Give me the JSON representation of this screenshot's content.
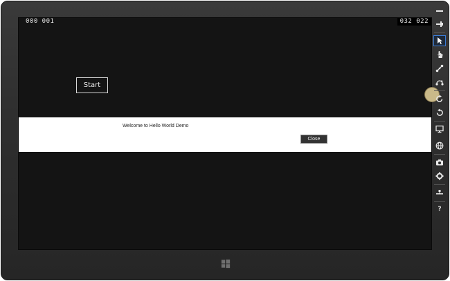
{
  "screen": {
    "counter_left": "000  001",
    "counter_right": "032  022"
  },
  "app": {
    "start_label": "Start"
  },
  "dialog": {
    "message": "Welcome to Hello World Demo",
    "close_label": "Close"
  },
  "toolbar": {
    "tools": [
      {
        "icon": "minimize-icon"
      },
      {
        "icon": "pin-icon"
      },
      {
        "icon": "mouse-pointer-icon",
        "selected": true
      },
      {
        "icon": "touch-hand-icon"
      },
      {
        "icon": "pinch-zoom-icon"
      },
      {
        "icon": "rotate-gesture-icon"
      },
      {
        "icon": "rotate-clockwise-icon"
      },
      {
        "icon": "rotate-counterclockwise-icon"
      },
      {
        "icon": "change-resolution-icon"
      },
      {
        "icon": "set-location-icon"
      },
      {
        "icon": "screenshot-camera-icon"
      },
      {
        "icon": "settings-gear-icon"
      },
      {
        "icon": "network-icon"
      },
      {
        "icon": "help-icon",
        "glyph": "?"
      }
    ]
  },
  "colors": {
    "screen_bg": "#141414",
    "selected_tool_border": "#3a7bd5",
    "handle": "#c9b989"
  }
}
